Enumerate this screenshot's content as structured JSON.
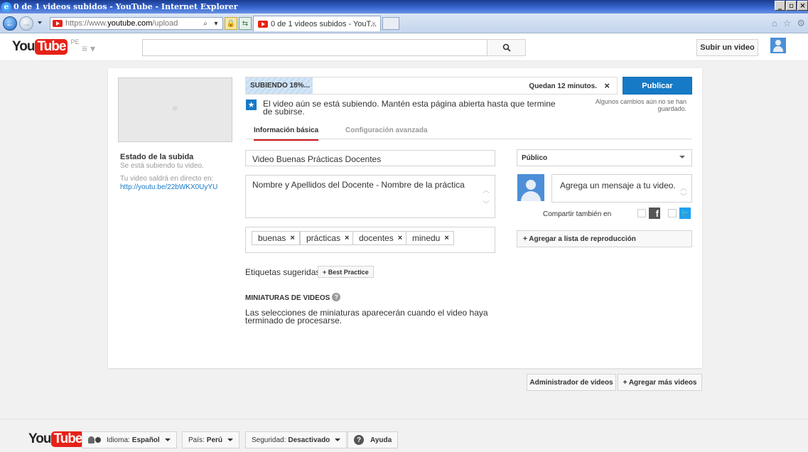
{
  "browser": {
    "window_title": "0 de 1 videos subidos - YouTube - Internet Explorer",
    "address_prefix": "https://www.",
    "address_domain": "youtube.com",
    "address_path": "/upload",
    "tab_title": "0 de 1 videos subidos - YouT..."
  },
  "header": {
    "logo_you": "You",
    "logo_tube": "Tube",
    "country_code": "PE",
    "search_placeholder": "",
    "upload_label": "Subir un video"
  },
  "upload": {
    "progress_label": "SUBIENDO 18%...",
    "progress_percent": 18,
    "time_remaining": "Quedan 12 minutos.",
    "publish_label": "Publicar",
    "publish_note": "Algunos cambios aún no se han guardado.",
    "info_message": "El video aún se está subiendo. Mantén esta página abierta hasta que termine de subirse.",
    "status_title": "Estado de la subida",
    "status_sub": "Se está subiendo tu video.",
    "live_label": "Tu video saldrá en directo en:",
    "live_link": "http://youtu.be/22bWKX0UyYU"
  },
  "tabs": {
    "basic": "Información básica",
    "advanced": "Configuración avanzada"
  },
  "form": {
    "title_value": "Video  Buenas Prácticas Docentes",
    "description_value": "Nombre y Apellidos del Docente - Nombre de la práctica",
    "tags": [
      "buenas",
      "prácticas",
      "docentes",
      "minedu"
    ],
    "suggested_label": "Etiquetas sugeridas:",
    "suggested_chip": "+ Best Practice",
    "thumbnails_title": "MINIATURAS DE VIDEOS",
    "thumbnails_message": "Las selecciones de miniaturas aparecerán cuando el video haya terminado de procesarse."
  },
  "sidebar": {
    "privacy_value": "Público",
    "message_placeholder": "Agrega un mensaje a tu video.",
    "share_label": "Compartir también en",
    "playlist_label": "+ Agregar a lista de reproducción"
  },
  "actions": {
    "manager_label": "Administrador de videos",
    "add_more_label": "+  Agregar más videos"
  },
  "footer": {
    "language_prefix": "Idioma:",
    "language_value": "Español",
    "country_prefix": "País:",
    "country_value": "Perú",
    "safety_prefix": "Seguridad:",
    "safety_value": "Desactivado",
    "help_label": "Ayuda"
  },
  "colors": {
    "accent_blue": "#167ac6",
    "brand_red": "#e62117",
    "tab_underline": "#cc181e"
  }
}
